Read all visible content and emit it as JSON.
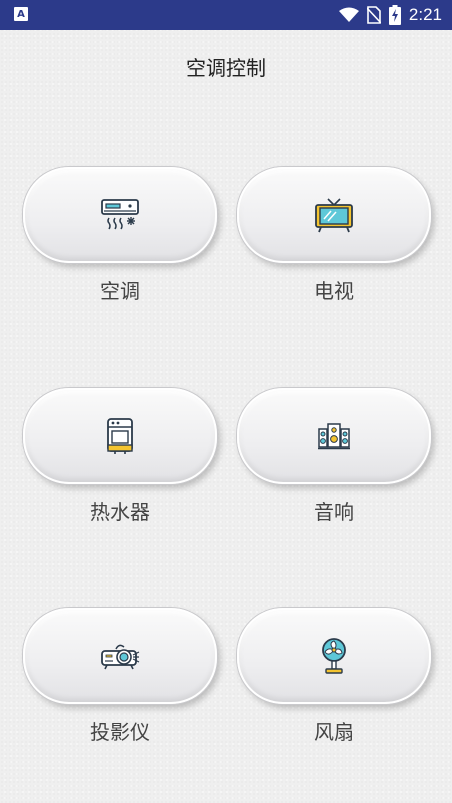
{
  "status_bar": {
    "app_icon_letter": "A",
    "time": "2:21",
    "icons": [
      "wifi-icon",
      "no-sim-icon",
      "battery-charging-icon"
    ]
  },
  "header": {
    "title": "空调控制"
  },
  "devices": [
    {
      "label": "空调",
      "icon": "air-conditioner-icon"
    },
    {
      "label": "电视",
      "icon": "television-icon"
    },
    {
      "label": "热水器",
      "icon": "water-heater-icon"
    },
    {
      "label": "音响",
      "icon": "speaker-icon"
    },
    {
      "label": "投影仪",
      "icon": "projector-icon"
    },
    {
      "label": "风扇",
      "icon": "fan-icon"
    }
  ],
  "colors": {
    "status_bar": "#2c3a8a",
    "background": "#efefef",
    "icon_stroke": "#2b3a4a",
    "icon_teal": "#5ec8d8",
    "icon_yellow": "#f4c430"
  }
}
